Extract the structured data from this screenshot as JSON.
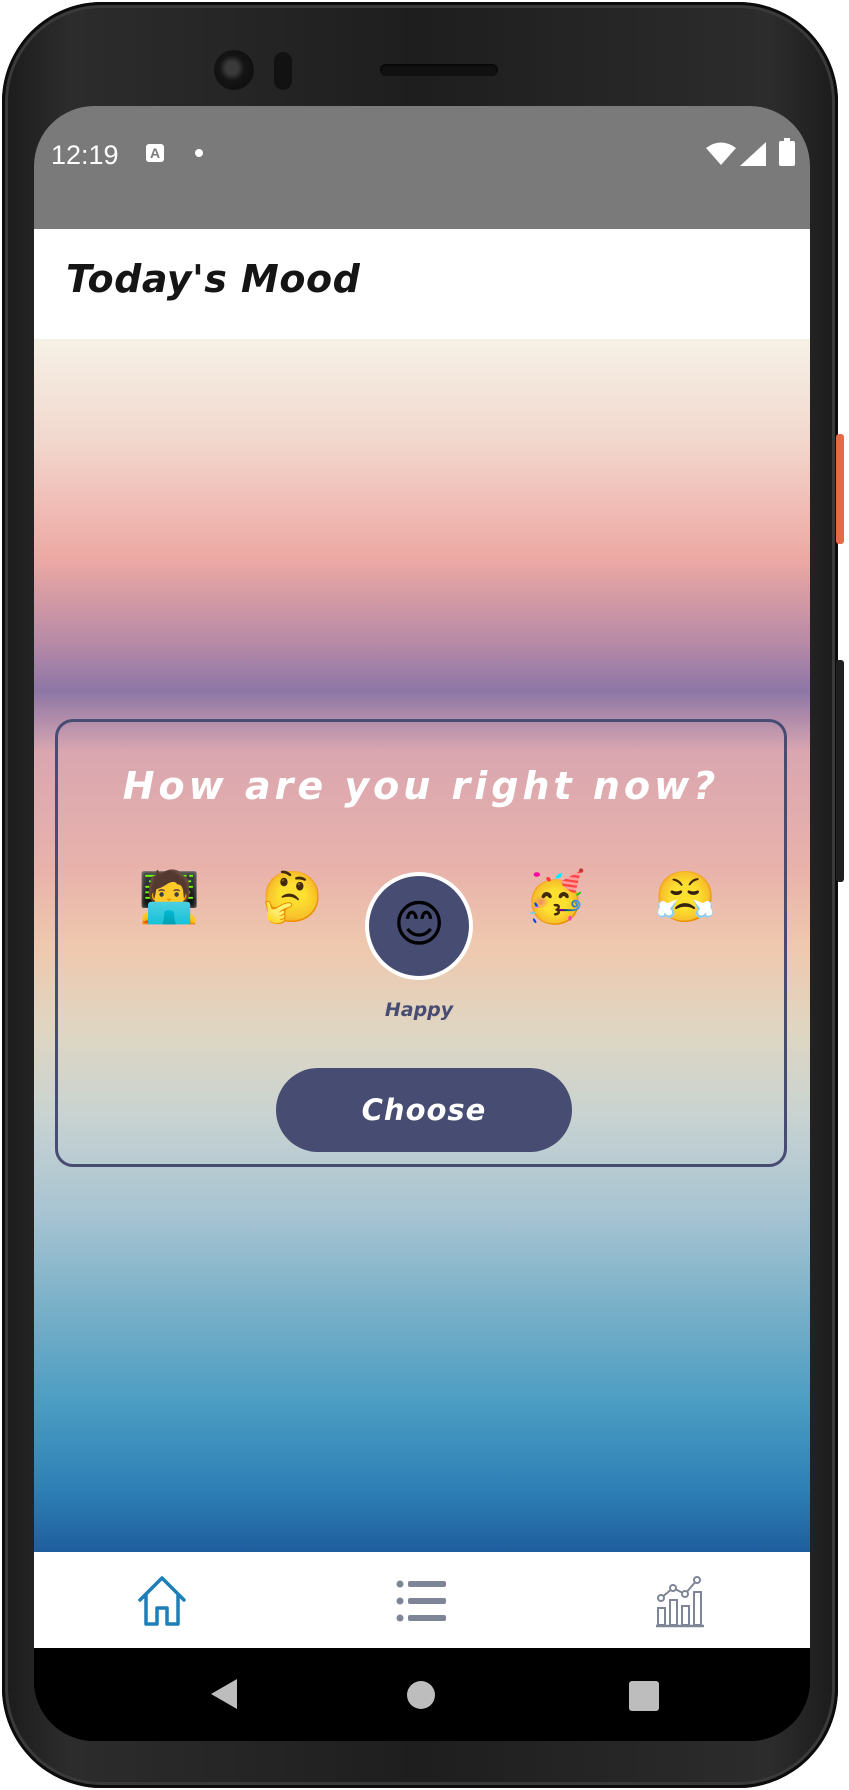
{
  "status_bar": {
    "time": "12:19",
    "notification_icon": "A",
    "icons": [
      "wifi-icon",
      "signal-icon",
      "battery-icon"
    ]
  },
  "app_bar": {
    "title": "Today's Mood"
  },
  "mood_card": {
    "question": "How are you right now?",
    "moods": [
      {
        "emoji": "🧑‍💻",
        "selected": false
      },
      {
        "emoji": "🤔",
        "selected": false
      },
      {
        "emoji": "😊",
        "label": "Happy",
        "selected": true
      },
      {
        "emoji": "🥳",
        "selected": false
      },
      {
        "emoji": "😤",
        "selected": false
      }
    ],
    "choose_label": "Choose"
  },
  "bottom_nav": {
    "items": [
      {
        "icon": "home-icon",
        "active": true
      },
      {
        "icon": "list-icon",
        "active": false
      },
      {
        "icon": "stats-chart-icon",
        "active": false
      }
    ],
    "active_color": "#1e7fb8",
    "inactive_color": "#7d8597"
  },
  "colors": {
    "accent": "#474c72",
    "status_bar": "#7a7a7a"
  }
}
